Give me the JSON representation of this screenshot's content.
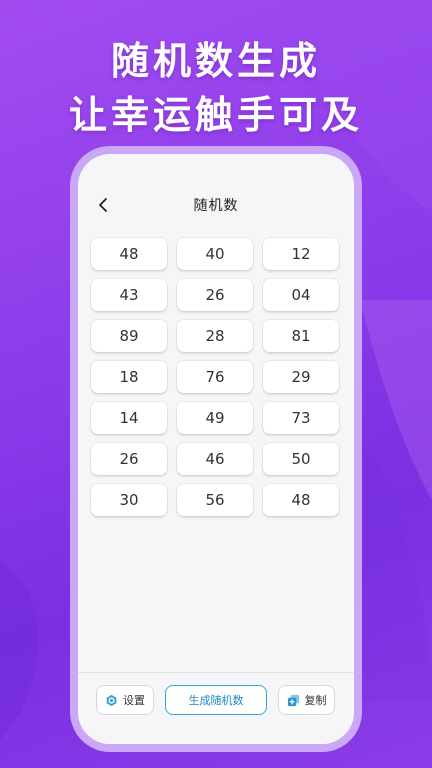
{
  "promo": {
    "line1": "随机数生成",
    "line2": "让幸运触手可及"
  },
  "header": {
    "title": "随机数",
    "back_icon": "chevron-left-icon"
  },
  "numbers": [
    "48",
    "40",
    "12",
    "43",
    "26",
    "04",
    "89",
    "28",
    "81",
    "18",
    "76",
    "29",
    "14",
    "49",
    "73",
    "26",
    "46",
    "50",
    "30",
    "56",
    "48"
  ],
  "toolbar": {
    "settings_label": "设置",
    "settings_icon": "gear-hexagon-icon",
    "generate_label": "生成随机数",
    "copy_label": "复制",
    "copy_icon": "copy-icon"
  },
  "colors": {
    "background": "#8d3cea",
    "phone_frame": "#c9a8f6",
    "accent": "#1e8ac3"
  }
}
